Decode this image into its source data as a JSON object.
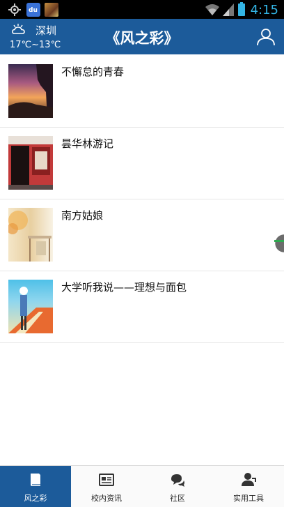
{
  "status_bar": {
    "time": "4:15",
    "baidu_label": "du"
  },
  "header": {
    "city": "深圳",
    "temperature": "17℃~13℃",
    "title": "《风之彩》"
  },
  "articles": [
    {
      "title": "不懈怠的青春"
    },
    {
      "title": "昙华林游记"
    },
    {
      "title": "南方姑娘"
    },
    {
      "title": "大学听我说——理想与面包"
    }
  ],
  "tabs": [
    {
      "label": "风之彩",
      "icon": "book-icon",
      "active": true
    },
    {
      "label": "校内资讯",
      "icon": "newspaper-icon",
      "active": false
    },
    {
      "label": "社区",
      "icon": "chat-bubbles-icon",
      "active": false
    },
    {
      "label": "实用工具",
      "icon": "person-tools-icon",
      "active": false
    }
  ],
  "colors": {
    "header_bg": "#1c5b9a",
    "active_tab_bg": "#1c5b9a",
    "status_accent": "#33b5e5"
  }
}
